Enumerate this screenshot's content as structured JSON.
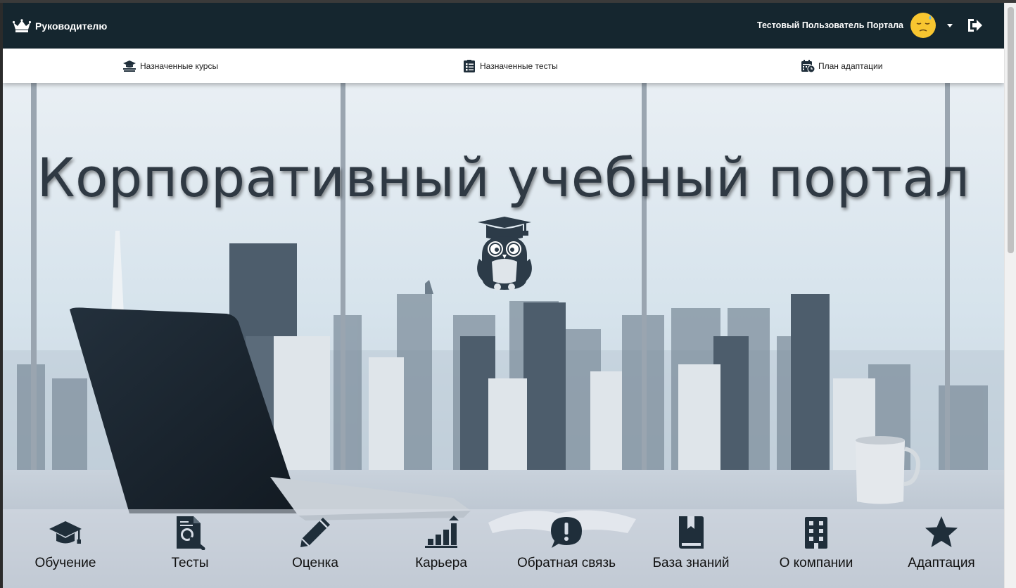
{
  "header": {
    "brand_label": "Руководителю",
    "brand_icon": "crown-icon",
    "user_name": "Тестовый Пользователь Портала",
    "avatar_icon": "avatar-emoji-icon",
    "dropdown_icon": "caret-down-icon",
    "logout_icon": "sign-out-icon"
  },
  "subnav": {
    "items": [
      {
        "label": "Назначенные курсы",
        "icon": "graduation-book-icon"
      },
      {
        "label": "Назначенные тесты",
        "icon": "checklist-icon"
      },
      {
        "label": "План адаптации",
        "icon": "calendar-clock-icon"
      }
    ]
  },
  "hero": {
    "title": "Корпоративный учебный портал",
    "logo_icon": "owl-graduate-icon"
  },
  "menu": {
    "items": [
      {
        "label": "Обучение",
        "icon": "graduation-cap-icon"
      },
      {
        "label": "Тесты",
        "icon": "file-search-icon"
      },
      {
        "label": "Оценка",
        "icon": "pencil-icon"
      },
      {
        "label": "Карьера",
        "icon": "chart-growth-icon"
      },
      {
        "label": "Обратная связь",
        "icon": "comment-exclamation-icon"
      },
      {
        "label": "База знаний",
        "icon": "book-icon"
      },
      {
        "label": "О компании",
        "icon": "building-icon"
      },
      {
        "label": "Адаптация",
        "icon": "star-icon"
      }
    ]
  },
  "colors": {
    "navbar": "#15262f",
    "icon_dark": "#1f2e3a",
    "title": "#2f3943"
  }
}
